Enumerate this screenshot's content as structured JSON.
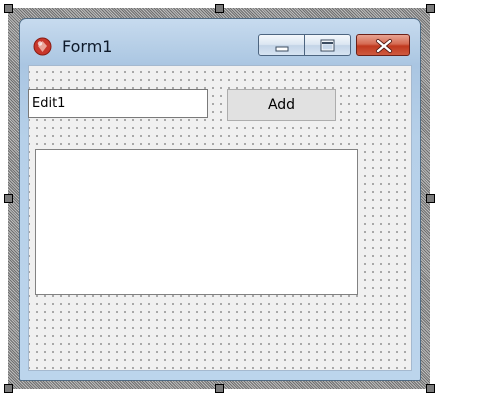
{
  "window": {
    "title": "Form1",
    "icon": "delphi-app-icon"
  },
  "caption_buttons": {
    "minimize_icon": "minimize-icon",
    "maximize_icon": "maximize-icon",
    "close_icon": "close-icon"
  },
  "edit": {
    "value": "Edit1"
  },
  "add_button": {
    "label": "Add"
  },
  "listbox": {
    "items": []
  },
  "colors": {
    "frame": "#b7cfe7",
    "close_button": "#c0391f",
    "client_background": "#f0f0f0"
  }
}
